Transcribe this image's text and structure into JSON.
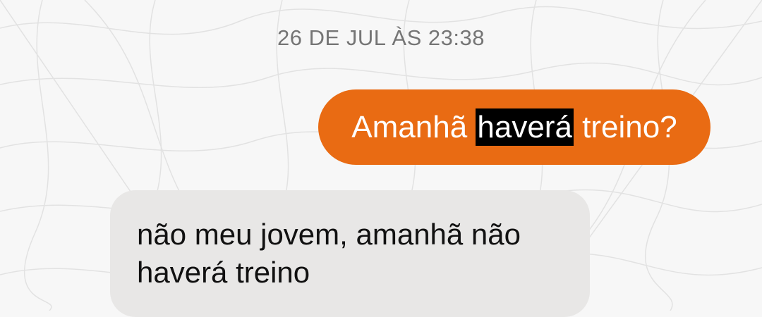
{
  "conversation": {
    "timestamp": "26 DE JUL ÀS 23:38",
    "outgoing": {
      "before": "Amanhã ",
      "highlight": "haverá",
      "after": " treino?"
    },
    "incoming": {
      "line1": "não meu jovem, amanhã não",
      "line2": "haverá treino"
    }
  },
  "colors": {
    "outgoing_bubble": "#e96b13",
    "incoming_bubble": "#e8e7e6",
    "highlight": "#000000",
    "background": "#f7f7f7"
  }
}
